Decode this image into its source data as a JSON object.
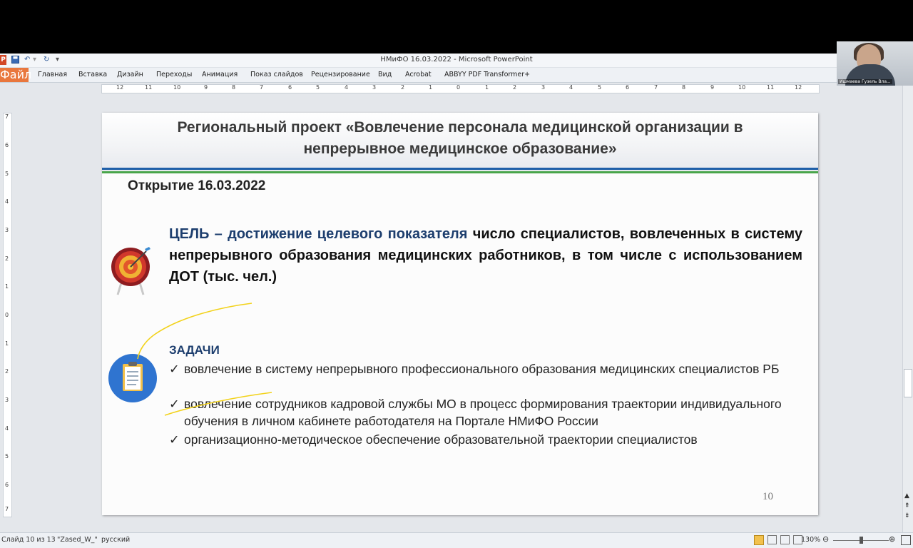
{
  "window": {
    "title": "НМиФО  16.03.2022  -  Microsoft PowerPoint",
    "ppt_logo": "P"
  },
  "ribbon": {
    "tabs": [
      "Файл",
      "Главная",
      "Вставка",
      "Дизайн",
      "Переходы",
      "Анимация",
      "Показ слайдов",
      "Рецензирование",
      "Вид",
      "Acrobat",
      "ABBYY PDF Transformer+"
    ]
  },
  "ruler": {
    "h_ticks": [
      "12",
      "11",
      "10",
      "9",
      "8",
      "7",
      "6",
      "5",
      "4",
      "3",
      "2",
      "1",
      "0",
      "1",
      "2",
      "3",
      "4",
      "5",
      "6",
      "7",
      "8",
      "9",
      "10",
      "11",
      "12"
    ],
    "v_ticks": [
      "7",
      "6",
      "5",
      "4",
      "3",
      "2",
      "1",
      "0",
      "1",
      "2",
      "3",
      "4",
      "5",
      "6",
      "7"
    ]
  },
  "slide": {
    "title_line1": "Региональный проект «Вовлечение персонала медицинской организации в",
    "title_line2": "непрерывное медицинское образование»",
    "opening": "Открытие 16.03.2022",
    "goal_lead": "ЦЕЛЬ – достижение целевого показателя",
    "goal_rest": " число специалистов, вовлеченных в систему непрерывного образования медицинских работников, в  том числе с использованием ДОТ (тыс. чел.)",
    "tasks_title": "ЗАДАЧИ",
    "check_mark": "✓",
    "tasks": [
      "вовлечение в систему непрерывного профессионального образования медицинских специалистов РБ",
      "вовлечение сотрудников кадровой службы МО в процесс формирования траектории индивидуального обучения в личном кабинете работодателя на Портале НМиФО России",
      "организационно-методическое обеспечение образовательной траектории специалистов"
    ],
    "page_number": "10"
  },
  "status": {
    "slide_info": "Слайд 10 из 13",
    "theme": "\"Zased_W_\"",
    "language": "русский",
    "zoom": "130%"
  },
  "webcam": {
    "name": "Ишмаева Гузель Вла..."
  },
  "colors": {
    "accent_blue": "#1f5fa8",
    "accent_green": "#49a54a",
    "file_tab": "#e9773d",
    "annotation": "#f2d21a"
  }
}
